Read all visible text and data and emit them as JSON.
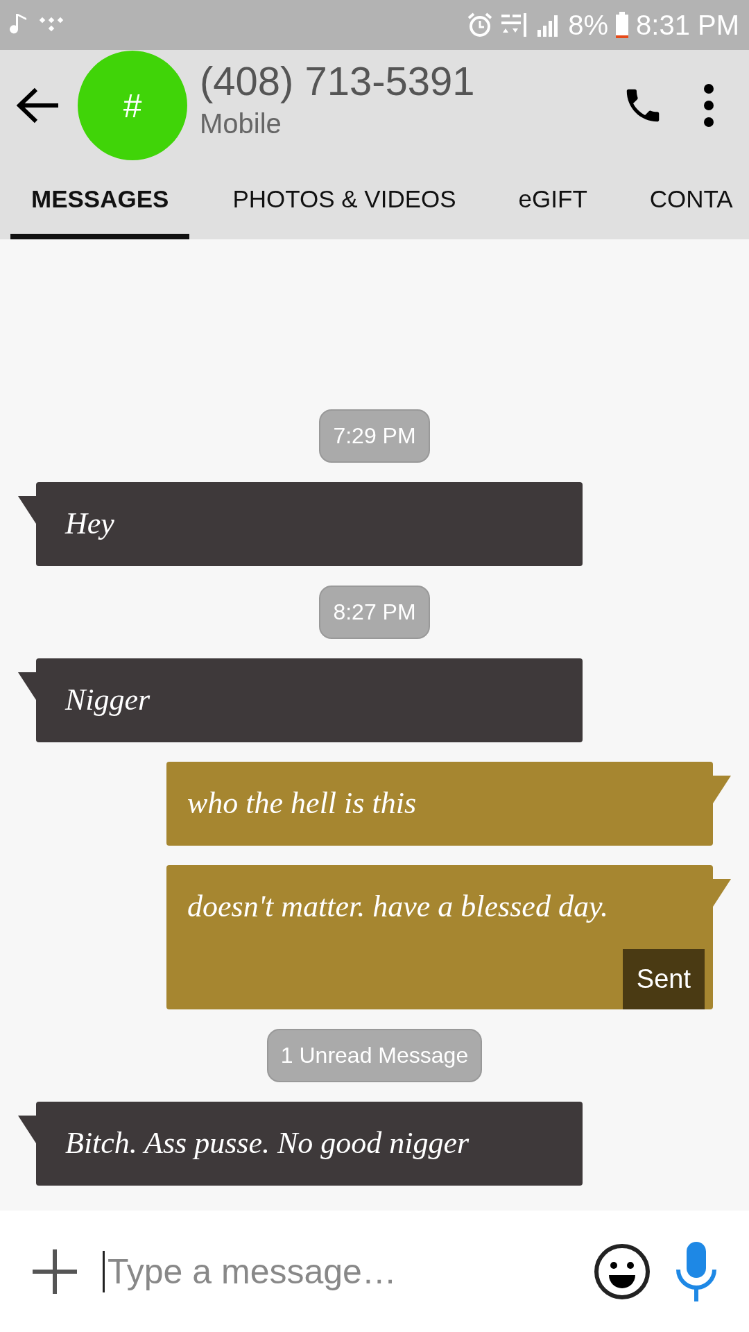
{
  "status_bar": {
    "battery": "8%",
    "time": "8:31 PM"
  },
  "header": {
    "avatar": "#",
    "title": "(408) 713-5391",
    "subtitle": "Mobile"
  },
  "tabs": [
    {
      "label": "MESSAGES",
      "selected": true
    },
    {
      "label": "PHOTOS & VIDEOS",
      "selected": false
    },
    {
      "label": "eGIFT",
      "selected": false
    },
    {
      "label": "CONTA",
      "selected": false
    }
  ],
  "messages": [
    {
      "kind": "time",
      "text": "7:29 PM"
    },
    {
      "kind": "incoming",
      "text": "Hey"
    },
    {
      "kind": "time",
      "text": "8:27 PM"
    },
    {
      "kind": "incoming",
      "text": "Nigger"
    },
    {
      "kind": "outgoing",
      "text": "who the hell is this"
    },
    {
      "kind": "outgoing",
      "text": "doesn't matter. have a blessed day.",
      "status": "Sent"
    },
    {
      "kind": "unread",
      "text": "1 Unread Message"
    },
    {
      "kind": "incoming",
      "text": "Bitch. Ass pusse. No good nigger"
    }
  ],
  "composer": {
    "placeholder": "Type a message…"
  }
}
